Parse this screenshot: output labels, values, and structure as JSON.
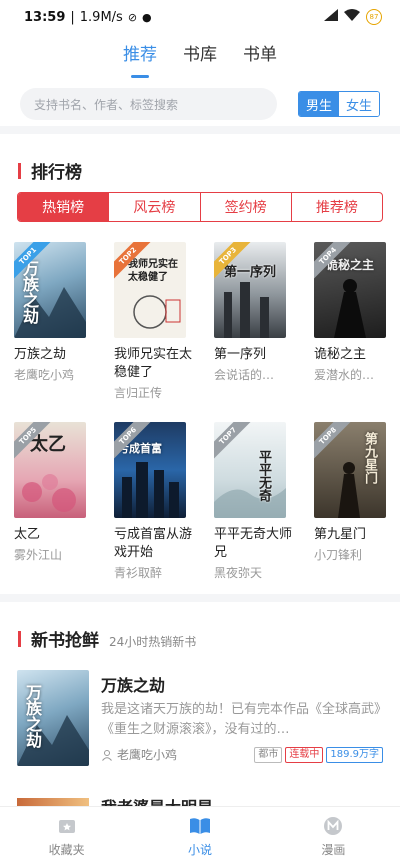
{
  "status": {
    "time": "13:59",
    "speed": "1.9M/s",
    "battery": "87"
  },
  "top_tabs": [
    {
      "label": "推荐",
      "active": true
    },
    {
      "label": "书库",
      "active": false
    },
    {
      "label": "书单",
      "active": false
    }
  ],
  "search": {
    "placeholder": "支持书名、作者、标签搜索"
  },
  "gender": {
    "male": "男生",
    "female": "女生"
  },
  "ranking": {
    "title": "排行榜",
    "tabs": [
      {
        "label": "热销榜",
        "active": true
      },
      {
        "label": "风云榜",
        "active": false
      },
      {
        "label": "签约榜",
        "active": false
      },
      {
        "label": "推荐榜",
        "active": false
      }
    ],
    "books": [
      {
        "rank": "TOP1",
        "cover_title": "万族之劫",
        "name": "万族之劫",
        "author": "老鹰吃小鸡",
        "badge_color": "#3aa0e8"
      },
      {
        "rank": "TOP2",
        "cover_title": "我师兄实在太稳健了",
        "name": "我师兄实在太稳健了",
        "author": "言归正传",
        "badge_color": "#e8733a"
      },
      {
        "rank": "TOP3",
        "cover_title": "第一序列",
        "name": "第一序列",
        "author": "会说话的…",
        "badge_color": "#e8b43a"
      },
      {
        "rank": "TOP4",
        "cover_title": "诡秘之主",
        "name": "诡秘之主",
        "author": "爱潜水的…",
        "badge_color": "#9aa0a6"
      },
      {
        "rank": "TOP5",
        "cover_title": "太乙",
        "name": "太乙",
        "author": "雾外江山",
        "badge_color": "#9aa0a6"
      },
      {
        "rank": "TOP6",
        "cover_title": "亏成首富",
        "name": "亏成首富从游戏开始",
        "author": "青衫取醉",
        "badge_color": "#9aa0a6"
      },
      {
        "rank": "TOP7",
        "cover_title": "平平无奇",
        "name": "平平无奇大师兄",
        "author": "黑夜弥天",
        "badge_color": "#9aa0a6"
      },
      {
        "rank": "TOP8",
        "cover_title": "第九星门",
        "name": "第九星门",
        "author": "小刀锋利",
        "badge_color": "#9aa0a6"
      }
    ]
  },
  "new_books": {
    "title": "新书抢鲜",
    "subtitle": "24小时热销新书",
    "item": {
      "cover_title": "万族之劫",
      "name": "万族之劫",
      "desc": "我是这诸天万族的劫！已有完本作品《全球高武》《重生之财源滚滚》，没有过的…",
      "author": "老鹰吃小鸡",
      "tags": [
        {
          "text": "都市",
          "color": "#888888"
        },
        {
          "text": "连载中",
          "color": "#e53e45"
        },
        {
          "text": "189.9万字",
          "color": "#3a8ee6"
        }
      ]
    },
    "peek_name": "我老婆是大明星"
  },
  "bottom_nav": [
    {
      "label": "收藏夹",
      "active": false
    },
    {
      "label": "小说",
      "active": true
    },
    {
      "label": "漫画",
      "active": false
    }
  ],
  "colors": {
    "accent": "#3a8ee6",
    "rank_red": "#e53e45"
  }
}
